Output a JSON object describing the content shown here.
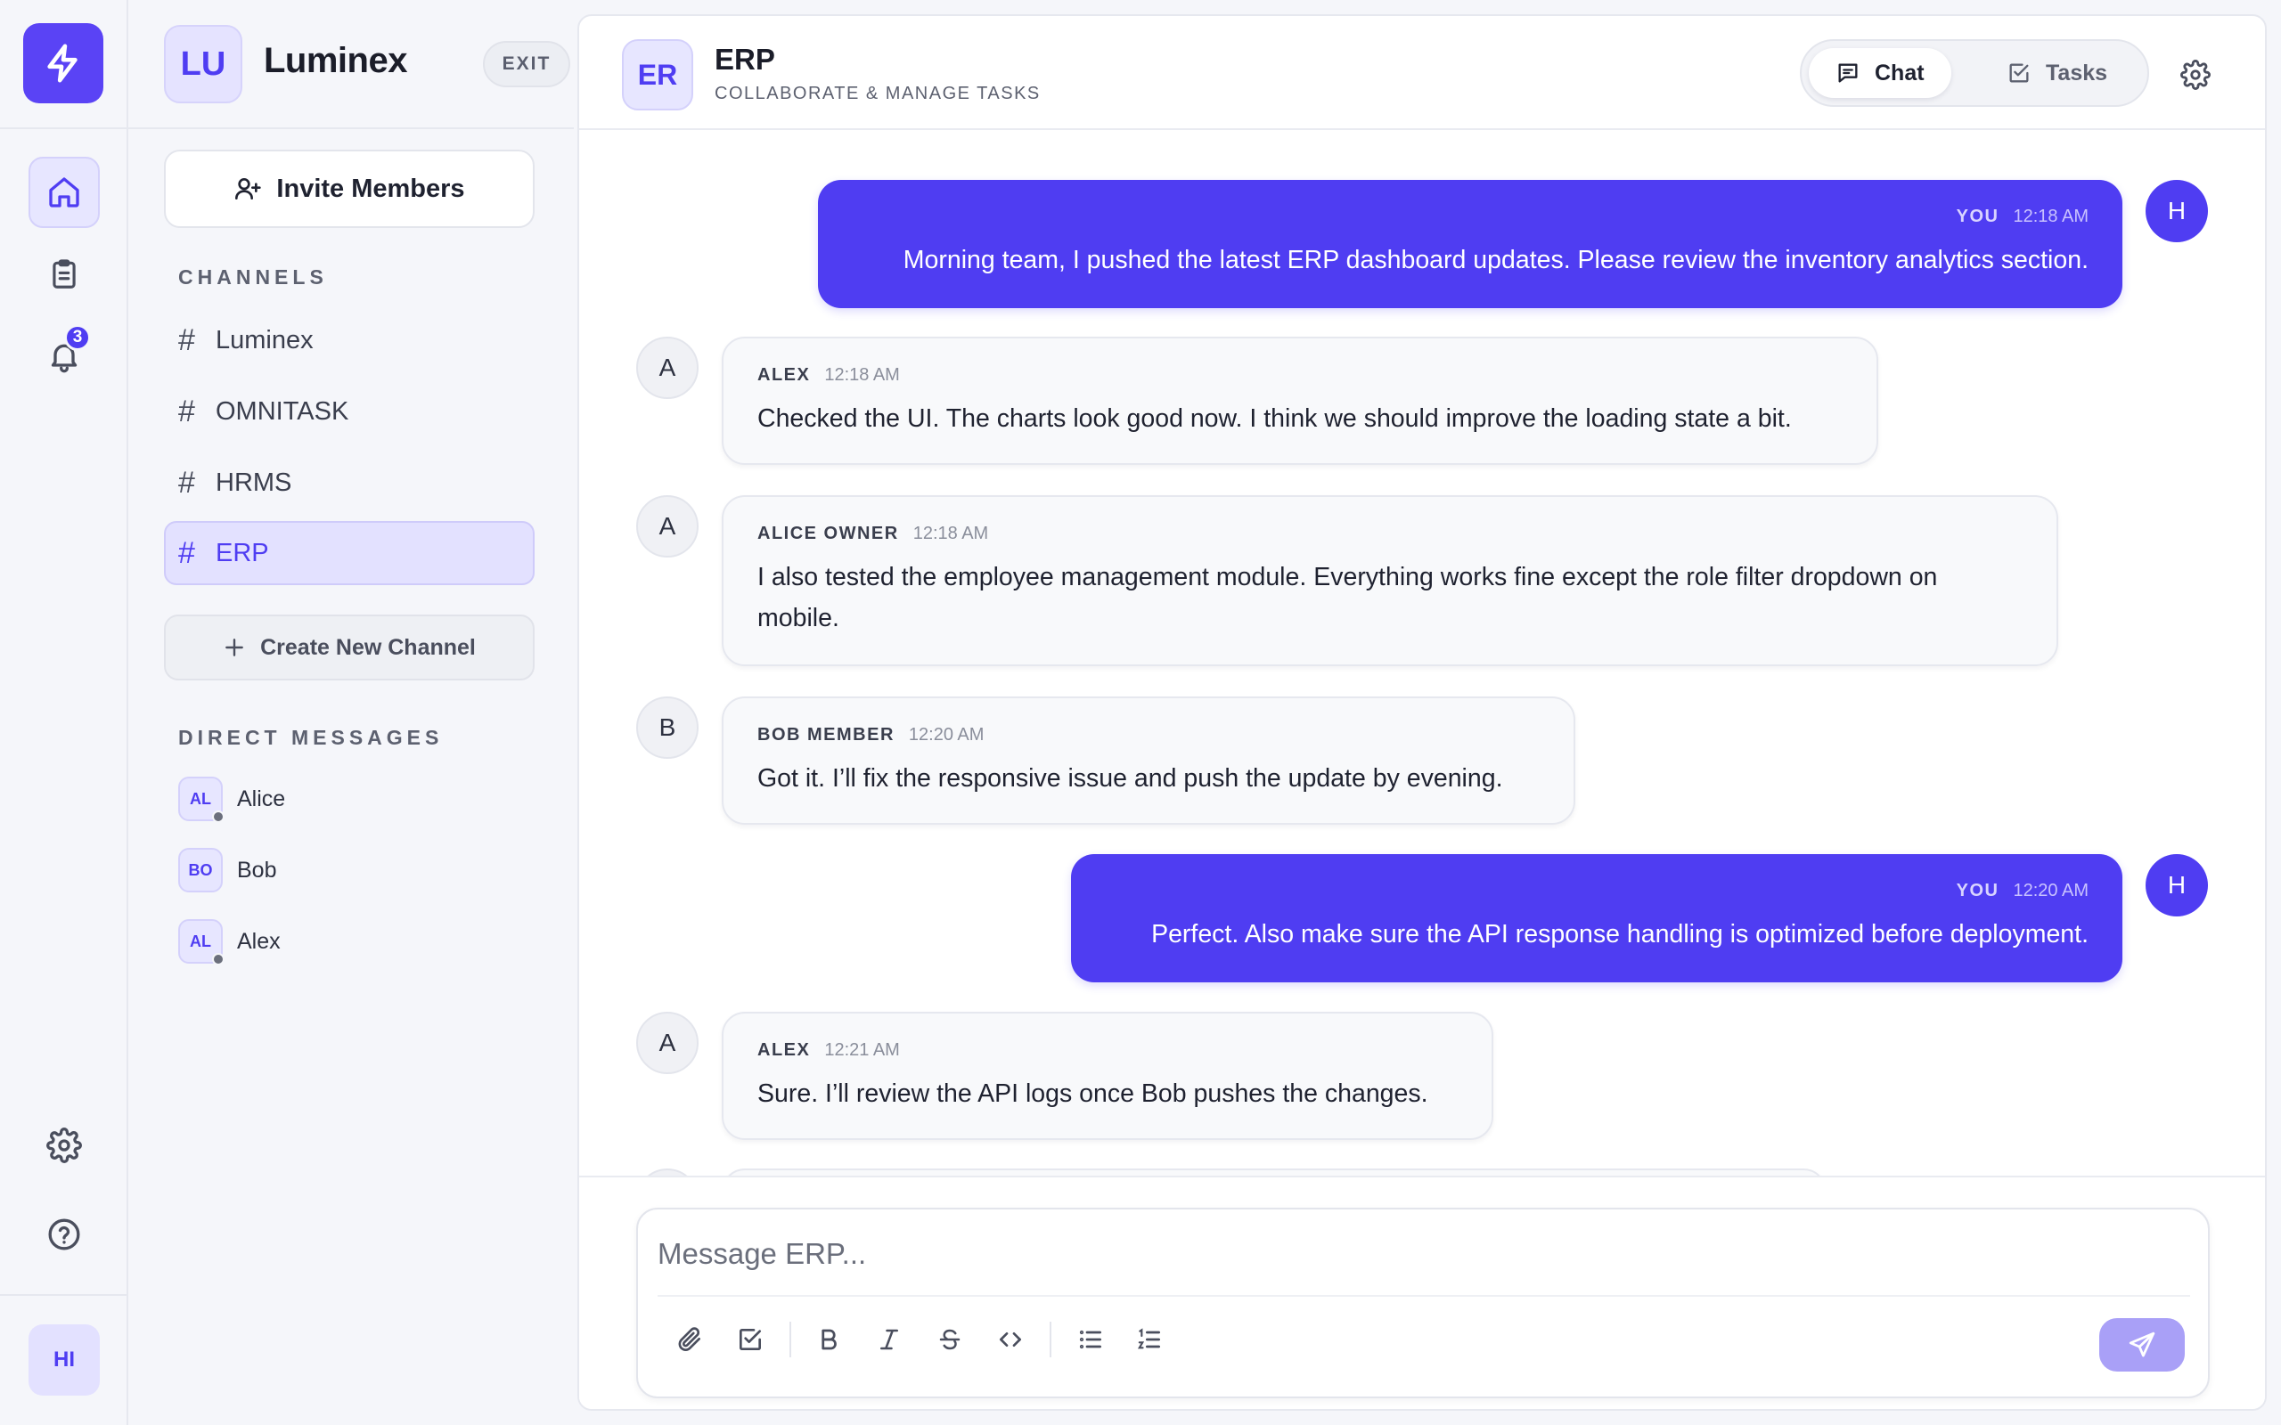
{
  "rail": {
    "notifications_badge": "3",
    "user_initials": "HI"
  },
  "workspace": {
    "initials": "LU",
    "name": "Luminex",
    "exit_label": "EXIT"
  },
  "sidebar": {
    "invite_label": "Invite Members",
    "channels_heading": "CHANNELS",
    "channels": [
      {
        "name": "Luminex",
        "active": false
      },
      {
        "name": "OMNITASK",
        "active": false
      },
      {
        "name": "HRMS",
        "active": false
      },
      {
        "name": "ERP",
        "active": true
      }
    ],
    "create_channel_label": "Create New Channel",
    "dm_heading": "DIRECT MESSAGES",
    "direct_messages": [
      {
        "initials": "AL",
        "name": "Alice"
      },
      {
        "initials": "BO",
        "name": "Bob"
      },
      {
        "initials": "AL",
        "name": "Alex"
      }
    ]
  },
  "header": {
    "channel_initials": "ER",
    "channel_name": "ERP",
    "subtitle": "COLLABORATE & MANAGE TASKS",
    "tabs": [
      {
        "label": "Chat",
        "active": true
      },
      {
        "label": "Tasks",
        "active": false
      }
    ]
  },
  "messages": [
    {
      "mine": true,
      "avatar": "H",
      "author": "YOU",
      "time": "12:18 AM",
      "text": "Morning team, I pushed the latest ERP dashboard updates. Please review the inventory analytics section."
    },
    {
      "mine": false,
      "avatar": "A",
      "author": "ALEX",
      "time": "12:18 AM",
      "text": "Checked the UI. The charts look good now. I think we should improve the loading state a bit."
    },
    {
      "mine": false,
      "avatar": "A",
      "author": "ALICE OWNER",
      "time": "12:18 AM",
      "text": "I also tested the employee management module. Everything works fine except the role filter dropdown on mobile."
    },
    {
      "mine": false,
      "avatar": "B",
      "author": "BOB MEMBER",
      "time": "12:20 AM",
      "text": "Got it. I’ll fix the responsive issue and push the update by evening."
    },
    {
      "mine": true,
      "avatar": "H",
      "author": "YOU",
      "time": "12:20 AM",
      "text": "Perfect. Also make sure the API response handling is optimized before deployment."
    },
    {
      "mine": false,
      "avatar": "A",
      "author": "ALEX",
      "time": "12:21 AM",
      "text": "Sure. I’ll review the API logs once Bob pushes the changes."
    }
  ],
  "composer": {
    "placeholder": "Message ERP..."
  },
  "colors": {
    "accent": "#4f3df2",
    "brand": "#5a43f5",
    "send_disabled": "#a9a0f7"
  }
}
